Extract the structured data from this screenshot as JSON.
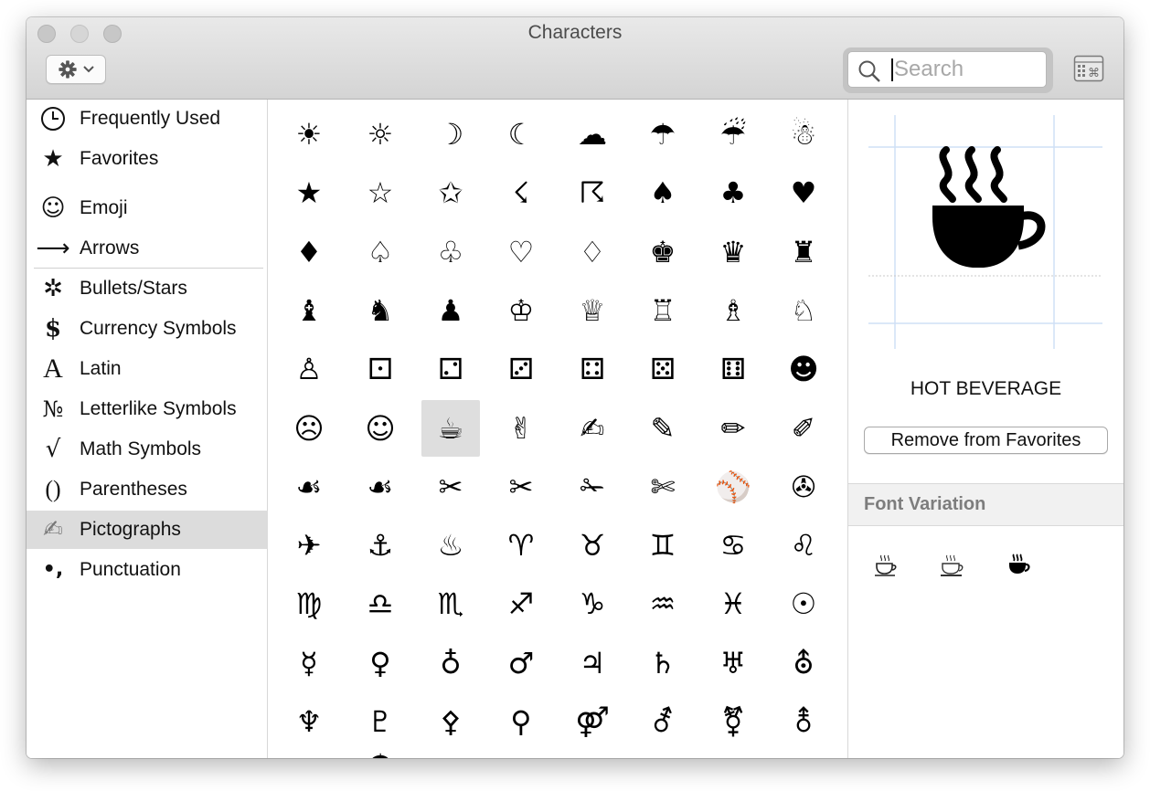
{
  "window": {
    "title": "Characters"
  },
  "toolbar": {
    "search_placeholder": "Search"
  },
  "sidebar": {
    "items": [
      {
        "label": "Frequently Used",
        "icon": "clock-icon",
        "glyph": ""
      },
      {
        "label": "Favorites",
        "icon": "star-icon",
        "glyph": "★"
      },
      {
        "label": "Emoji",
        "icon": "smiley-icon",
        "glyph": "☺"
      },
      {
        "label": "Arrows",
        "icon": "arrow-icon",
        "glyph": "⟶"
      },
      {
        "label": "Bullets/Stars",
        "icon": "asterisk-icon",
        "glyph": "✲"
      },
      {
        "label": "Currency Symbols",
        "icon": "dollar-icon",
        "glyph": "$"
      },
      {
        "label": "Latin",
        "icon": "latin-a-icon",
        "glyph": "A"
      },
      {
        "label": "Letterlike Symbols",
        "icon": "numero-icon",
        "glyph": "№"
      },
      {
        "label": "Math Symbols",
        "icon": "square-root-icon",
        "glyph": "√"
      },
      {
        "label": "Parentheses",
        "icon": "parentheses-icon",
        "glyph": "()"
      },
      {
        "label": "Pictographs",
        "icon": "writing-hand-icon",
        "glyph": "✍"
      },
      {
        "label": "Punctuation",
        "icon": "punctuation-icon",
        "glyph": "•,"
      }
    ],
    "selected_index": 10
  },
  "grid": {
    "rows": [
      [
        "☀",
        "☼",
        "☽",
        "☾",
        "☁",
        "☂",
        "☔",
        "☃"
      ],
      [
        "★",
        "☆",
        "✩",
        "☇",
        "☈",
        "♠",
        "♣",
        "♥"
      ],
      [
        "♦",
        "♤",
        "♧",
        "♡",
        "♢",
        "♚",
        "♛",
        "♜"
      ],
      [
        "♝",
        "♞",
        "♟",
        "♔",
        "♕",
        "♖",
        "♗",
        "♘"
      ],
      [
        "♙",
        "⚀",
        "⚁",
        "⚂",
        "⚃",
        "⚄",
        "⚅",
        "☻"
      ],
      [
        "☹",
        "☺",
        "☕",
        "✌",
        "✍",
        "✎",
        "✏",
        "✐"
      ],
      [
        "☙",
        "☙",
        "✂",
        "✂",
        "✁",
        "✄",
        "⚾",
        "✇"
      ],
      [
        "✈",
        "⚓",
        "♨",
        "♈",
        "♉",
        "♊",
        "♋",
        "♌"
      ],
      [
        "♍",
        "♎",
        "♏",
        "♐",
        "♑",
        "♒",
        "♓",
        "☉"
      ],
      [
        "☿",
        "♀",
        "♁",
        "♂",
        "♃",
        "♄",
        "♅",
        "⛢"
      ],
      [
        "♆",
        "♇",
        "⚴",
        "⚲",
        "⚤",
        "⚦",
        "⚧",
        "⚨"
      ]
    ],
    "partial_row": [
      "",
      "☂",
      "",
      "",
      "",
      "",
      "",
      ""
    ],
    "selected": {
      "row": 5,
      "col": 2
    }
  },
  "detail": {
    "glyph": "☕",
    "name": "HOT BEVERAGE",
    "remove_label": "Remove from Favorites",
    "font_variation_title": "Font Variation",
    "variations": [
      "☕",
      "☕",
      "☕"
    ]
  }
}
